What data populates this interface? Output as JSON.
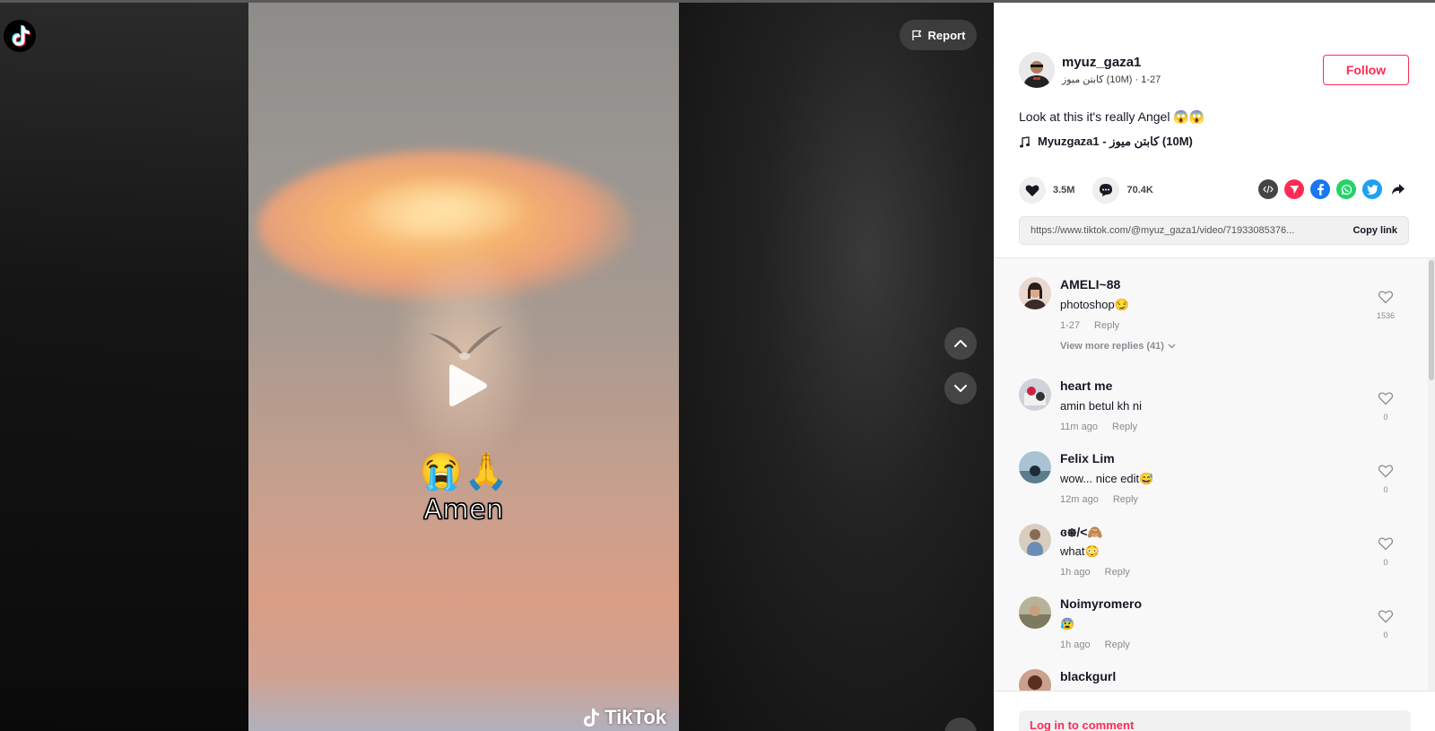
{
  "app": {
    "name": "TikTok"
  },
  "video": {
    "sticker_emoji": "😭🙏",
    "sticker_text": "Amen",
    "watermark": "TikTok",
    "report_label": "Report"
  },
  "author": {
    "username": "myuz_gaza1",
    "subtitle": "كابتن ميوز (10M) · 1-27",
    "follow_label": "Follow"
  },
  "post": {
    "caption": "Look at this it's really Angel 😱😱",
    "music": "Myuzgaza1 - كابتن ميوز (10M)",
    "likes": "3.5M",
    "comments": "70.4K",
    "link": "https://www.tiktok.com/@myuz_gaza1/video/71933085376...",
    "copy_label": "Copy link"
  },
  "share_icons": [
    {
      "name": "embed-icon",
      "color": "#444444"
    },
    {
      "name": "send-icon",
      "color": "#fe2c55"
    },
    {
      "name": "facebook-icon",
      "color": "#1877f2"
    },
    {
      "name": "whatsapp-icon",
      "color": "#25d366"
    },
    {
      "name": "twitter-icon",
      "color": "#1da1f2"
    },
    {
      "name": "share-arrow-icon",
      "color": "#161823"
    }
  ],
  "comments": [
    {
      "name": "AMELI~88",
      "text": "photoshop😏",
      "time": "1-27",
      "reply": "Reply",
      "likes": "1536"
    },
    {
      "name": "heart me",
      "text": "amin betul kh ni",
      "time": "11m ago",
      "reply": "Reply",
      "likes": "0"
    },
    {
      "name": "Felix Lim",
      "text": "wow... nice edit😅",
      "time": "12m ago",
      "reply": "Reply",
      "likes": "0"
    },
    {
      "name": "ɞ᪥/<🙈",
      "text": "what😳",
      "time": "1h ago",
      "reply": "Reply",
      "likes": "0"
    },
    {
      "name": "Noimyromero",
      "text": "😰",
      "time": "1h ago",
      "reply": "Reply",
      "likes": "0"
    },
    {
      "name": "blackgurl",
      "text": "",
      "time": "",
      "reply": "",
      "likes": ""
    }
  ],
  "more_replies": "View more replies (41)",
  "login_prompt": "Log in to comment",
  "colors": {
    "accent": "#fe2c55",
    "panel_bg": "#ffffff",
    "comments_bg": "#f8f8f8"
  }
}
